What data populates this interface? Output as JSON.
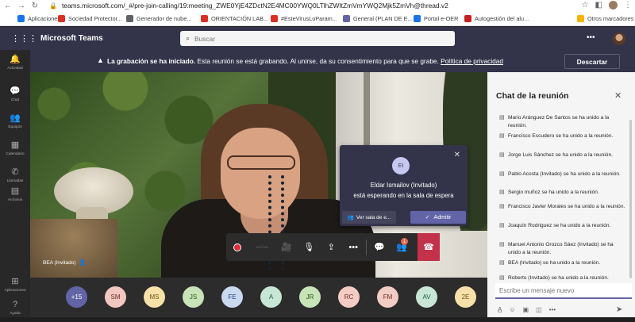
{
  "browser": {
    "url": "teams.microsoft.com/_#/pre-join-calling/19:meeting_ZWE0YjE4ZDctN2E4MC00YWQ0LTlhZWItZmVmYWQ2Mjk5ZmVh@thread.v2",
    "bookmarks": [
      {
        "label": "Aplicaciones",
        "color": "#1a73e8"
      },
      {
        "label": "Sociedad Protector...",
        "color": "#d93025"
      },
      {
        "label": "Generador de nube...",
        "color": "#5f6368"
      },
      {
        "label": "ORIENTACIÓN LAB...",
        "color": "#d93025"
      },
      {
        "label": "#EsteVirusLoParam...",
        "color": "#d93025"
      },
      {
        "label": "General (PLAN DE E...",
        "color": "#6264a7"
      },
      {
        "label": "Portal e-OER",
        "color": "#1a73e8"
      },
      {
        "label": "Autogestión del alu...",
        "color": "#c5221f"
      },
      {
        "label": "Otros marcadores",
        "color": "#f4b400"
      }
    ]
  },
  "header": {
    "app_name": "Microsoft Teams",
    "search_placeholder": "Buscar"
  },
  "rail": [
    {
      "label": "Actividad",
      "icon": "bell-icon",
      "glyph": "🔔"
    },
    {
      "label": "Chat",
      "icon": "chat-icon",
      "glyph": "💬"
    },
    {
      "label": "Equipos",
      "icon": "teams-icon",
      "glyph": "👥"
    },
    {
      "label": "Calendario",
      "icon": "calendar-icon",
      "glyph": "▦"
    },
    {
      "label": "Llamadas",
      "icon": "phone-icon",
      "glyph": "✆"
    },
    {
      "label": "Archivos",
      "icon": "files-icon",
      "glyph": "▤"
    },
    {
      "label": "Aplicaciones",
      "icon": "apps-icon",
      "glyph": "⊞"
    },
    {
      "label": "Ayuda",
      "icon": "help-icon",
      "glyph": "?"
    }
  ],
  "recording": {
    "bold": "La grabación se ha iniciado.",
    "text": " Esta reunión se está grabando. Al unirse, da su consentimiento para que se grabe. ",
    "link": "Política de privacidad",
    "dismiss": "Descartar"
  },
  "video": {
    "name": "BEA (Invitado)"
  },
  "lobby": {
    "initials": "EI",
    "line1": "Eldar Ismailov (Invitado)",
    "line2": "está esperando en la sala de espera",
    "view": "Ver sala de e...",
    "admit": "Admitir"
  },
  "controls": {
    "timer": "—:—",
    "participants_badge": "1"
  },
  "participants": [
    {
      "initials": "+15",
      "color": "#6264a7",
      "text_color": "#ffffff"
    },
    {
      "initials": "SM",
      "color": "#f1c7c0",
      "text_color": "#6b2d22"
    },
    {
      "initials": "MS",
      "color": "#f7e1a8",
      "text_color": "#6b5311"
    },
    {
      "initials": "JS",
      "color": "#c7e3b8",
      "text_color": "#2b5a16"
    },
    {
      "initials": "FE",
      "color": "#c9d9f0",
      "text_color": "#1f3d6b"
    },
    {
      "initials": "A",
      "color": "#c8e6d6",
      "text_color": "#205c3d"
    },
    {
      "initials": "JR",
      "color": "#c7e3b8",
      "text_color": "#2b5a16"
    },
    {
      "initials": "RC",
      "color": "#f3cdc3",
      "text_color": "#6b2d22"
    },
    {
      "initials": "FM",
      "color": "#f3cdc3",
      "text_color": "#6b2d22"
    },
    {
      "initials": "AV",
      "color": "#c8e6d6",
      "text_color": "#205c3d"
    },
    {
      "initials": "2E",
      "color": "#f7e1a8",
      "text_color": "#6b5311"
    }
  ],
  "chat": {
    "title": "Chat de la reunión",
    "messages": [
      {
        "name": "Mario Aránguez De Santos",
        "text": " se ha unido a la reunión."
      },
      {
        "name": "Francisco Escudero",
        "text": " se ha unido a la reunión."
      },
      {
        "name": "Jorge Luis Sánchez",
        "text": " se ha unido a la reunión."
      },
      {
        "name": "Pablo Acosta (Invitado)",
        "text": " se ha unido a la reunión."
      },
      {
        "name": "Sergio muñoz",
        "text": " se ha unido a la reunión."
      },
      {
        "name": "Francisco Javier Morales",
        "text": " se ha unido a la reunión."
      },
      {
        "name": "Joaquín Rodriguez",
        "text": " se ha unido a la reunión."
      },
      {
        "name": "Manuel Antonio Orozco Sáez (Invitado)",
        "text": " se ha unido a la reunión."
      },
      {
        "name": "BEA (Invitado)",
        "text": " se ha unido a la reunión."
      },
      {
        "name": "Roberto (Invitado)",
        "text": " se ha unido a la reunión."
      }
    ],
    "compose_placeholder": "Escribe un mensaje nuevo"
  }
}
